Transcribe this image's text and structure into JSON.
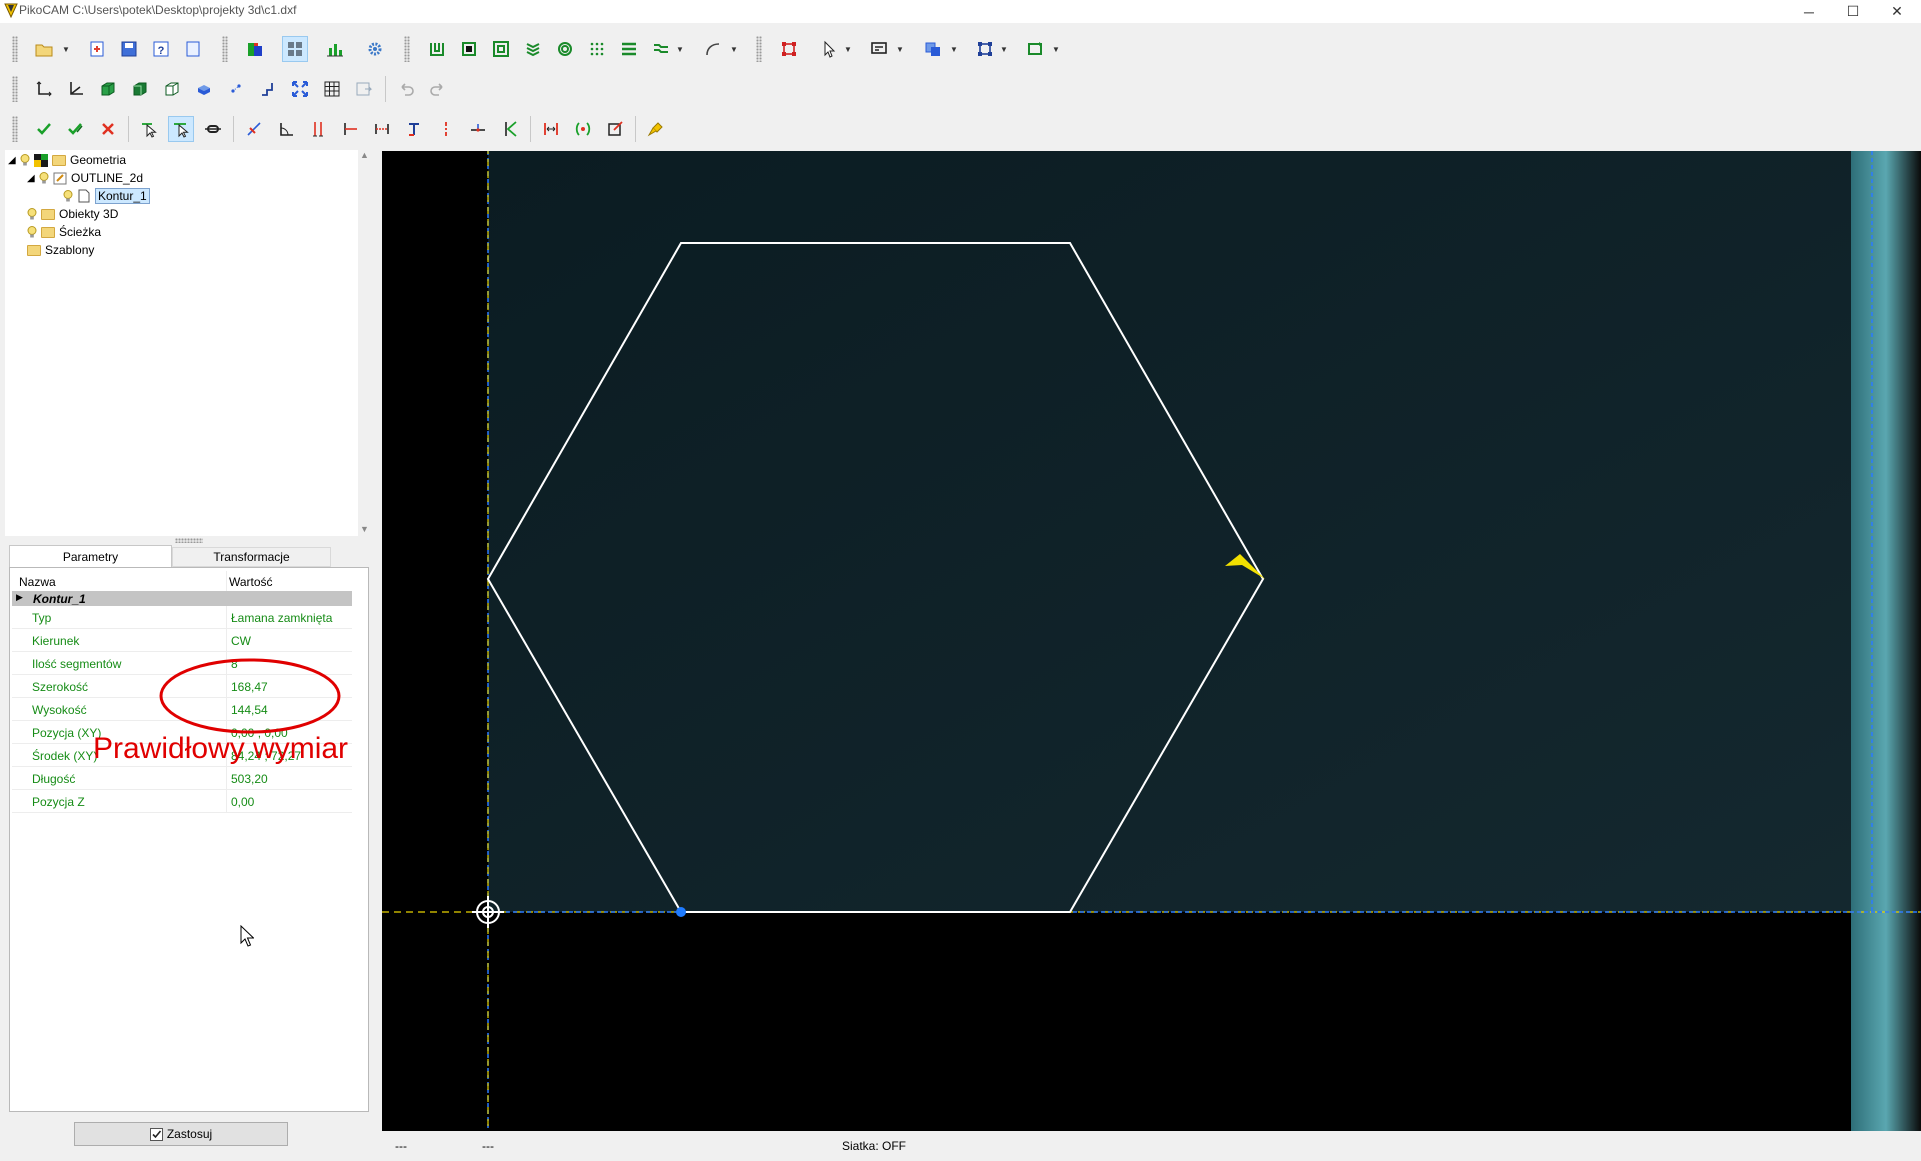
{
  "window": {
    "title": "PikoCAM  C:\\Users\\potek\\Desktop\\projekty 3d\\c1.dxf",
    "minimize": "─",
    "maximize": "☐",
    "close": "✕"
  },
  "tree": {
    "geometry": "Geometria",
    "outline": "OUTLINE_2d",
    "contour": "Kontur_1",
    "objects3d": "Obiekty 3D",
    "path": "Ścieżka",
    "templates": "Szablony"
  },
  "props": {
    "tab_params": "Parametry",
    "tab_transform": "Transformacje",
    "col_name": "Nazwa",
    "col_value": "Wartość",
    "group": "Kontur_1",
    "rows": [
      {
        "name": "Typ",
        "value": "Łamana zamknięta"
      },
      {
        "name": "Kierunek",
        "value": "CW"
      },
      {
        "name": "Ilość segmentów",
        "value": "8"
      },
      {
        "name": "Szerokość",
        "value": "168,47"
      },
      {
        "name": "Wysokość",
        "value": "144,54"
      },
      {
        "name": "Pozycja (XY)",
        "value": "0,00 ; 0,00"
      },
      {
        "name": "Środek (XY)",
        "value": "84,24 ; 72,27"
      },
      {
        "name": "Długość",
        "value": "503,20"
      },
      {
        "name": "Pozycja Z",
        "value": "0,00"
      }
    ],
    "apply": "Zastosuj"
  },
  "annotation": "Prawidłowy wymiar",
  "status": {
    "left1": "---",
    "left2": "---",
    "grid": "Siatka: OFF"
  },
  "colors": {
    "viewport_bg": "#000000",
    "work_area": "#0d1e24",
    "contour": "#ffffff",
    "axis_y": "#e8d400",
    "axis_blue": "#2a7bff",
    "annotation": "#e00000",
    "label_green": "#168c16"
  }
}
